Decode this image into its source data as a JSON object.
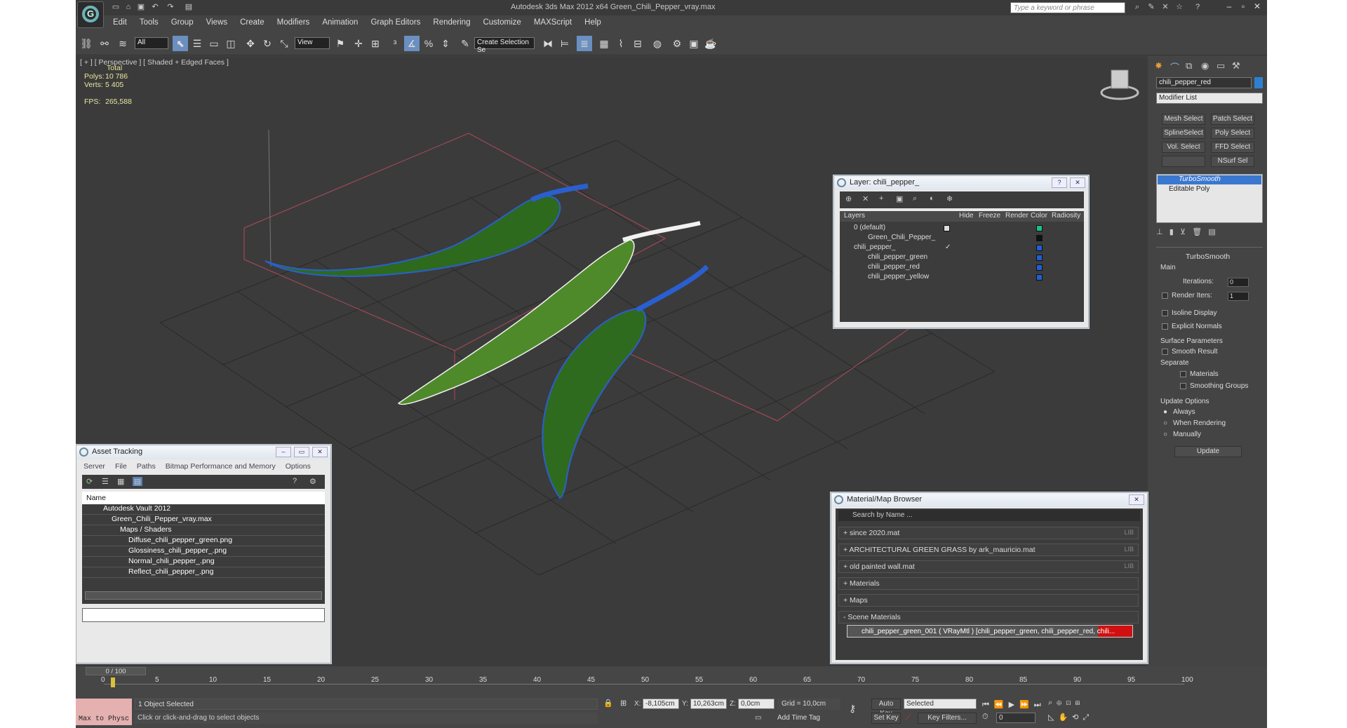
{
  "window": {
    "title": "Autodesk 3ds Max  2012 x64      Green_Chili_Pepper_vray.max"
  },
  "search": {
    "placeholder": "Type a keyword or phrase"
  },
  "menu": [
    "Edit",
    "Tools",
    "Group",
    "Views",
    "Create",
    "Modifiers",
    "Animation",
    "Graph Editors",
    "Rendering",
    "Customize",
    "MAXScript",
    "Help"
  ],
  "toolbar": {
    "filter": "All",
    "ref_coord": "View",
    "named_sel": "Create Selection Se"
  },
  "viewport": {
    "label": "[ + ] [ Perspective ] [ Shaded + Edged Faces ]",
    "stats": {
      "total_label": "Total",
      "polys_label": "Polys:",
      "polys": "10 786",
      "verts_label": "Verts:",
      "verts": "5 405",
      "fps_label": "FPS:",
      "fps": "265,588"
    }
  },
  "layer_window": {
    "title": "Layer: chili_pepper_",
    "columns": [
      "Layers",
      "Hide",
      "Freeze",
      "Render",
      "Color",
      "Radiosity"
    ],
    "rows": [
      {
        "name": "0 (default)",
        "color": "#1dbf87"
      },
      {
        "name": "Green_Chili_Pepper_",
        "color": "#111111"
      },
      {
        "name": "chili_pepper_",
        "color": "#1f5fd6"
      },
      {
        "name": "chili_pepper_green",
        "color": "#1f5fd6"
      },
      {
        "name": "chili_pepper_red",
        "color": "#1f5fd6"
      },
      {
        "name": "chili_pepper_yellow",
        "color": "#1f5fd6"
      }
    ]
  },
  "asset_tracking": {
    "title": "Asset Tracking",
    "menu": [
      "Server",
      "File",
      "Paths",
      "Bitmap Performance and Memory",
      "Options"
    ],
    "column": "Name",
    "rows": [
      "Autodesk Vault 2012",
      "Green_Chili_Pepper_vray.max",
      "Maps / Shaders",
      "Diffuse_chili_pepper_green.png",
      "Glossiness_chili_pepper_.png",
      "Normal_chili_pepper_.png",
      "Reflect_chili_pepper_.png"
    ]
  },
  "material_browser": {
    "title": "Material/Map Browser",
    "search": "Search by Name ...",
    "rows": [
      {
        "label": "+ since 2020.mat",
        "lib": "LIB"
      },
      {
        "label": "+ ARCHITECTURAL GREEN GRASS by ark_mauricio.mat",
        "lib": "LIB"
      },
      {
        "label": "+ old painted wall.mat",
        "lib": "LIB"
      },
      {
        "label": "+ Materials",
        "lib": ""
      },
      {
        "label": "+ Maps",
        "lib": ""
      },
      {
        "label": "- Scene Materials",
        "lib": ""
      }
    ],
    "scene_material": "chili_pepper_green_001 ( VRayMtl ) [chili_pepper_green, chili_pepper_red, chili..."
  },
  "command_panel": {
    "object_name": "chili_pepper_red",
    "modifier_list": "Modifier List",
    "buttons": [
      "Mesh Select",
      "Patch Select",
      "SplineSelect",
      "Poly Select",
      "Vol. Select",
      "FFD Select",
      "",
      "NSurf Sel"
    ],
    "stack": [
      "TurboSmooth",
      "Editable Poly"
    ],
    "rollout": "TurboSmooth",
    "main": "Main",
    "iterations_label": "Iterations:",
    "iterations": "0",
    "render_iters_label": "Render Iters:",
    "render_iters": "1",
    "isoline": "Isoline Display",
    "explicit": "Explicit Normals",
    "surface_params": "Surface Parameters",
    "smooth_result": "Smooth Result",
    "separate": "Separate",
    "materials": "Materials",
    "smoothing_groups": "Smoothing Groups",
    "update_options": "Update Options",
    "always": "Always",
    "when_rendering": "When Rendering",
    "manually": "Manually",
    "update": "Update"
  },
  "timeline": {
    "frame": "0 / 100",
    "ticks": [
      "0",
      "5",
      "10",
      "15",
      "20",
      "25",
      "30",
      "35",
      "40",
      "45",
      "50",
      "55",
      "60",
      "65",
      "70",
      "75",
      "80",
      "85",
      "90",
      "95",
      "100"
    ]
  },
  "status": {
    "maxscript": "Max to Physc",
    "selected": "1 Object Selected",
    "prompt": "Click or click-and-drag to select objects",
    "x_label": "X:",
    "x": "-8,105cm",
    "y_label": "Y:",
    "y": "10,263cm",
    "z_label": "Z:",
    "z": "0,0cm",
    "grid": "Grid = 10,0cm",
    "auto_key": "Auto Key",
    "set_key": "Set Key",
    "key_mode": "Selected",
    "add_time_tag": "Add Time Tag",
    "key_filters": "Key Filters...",
    "frame_field": "0"
  }
}
